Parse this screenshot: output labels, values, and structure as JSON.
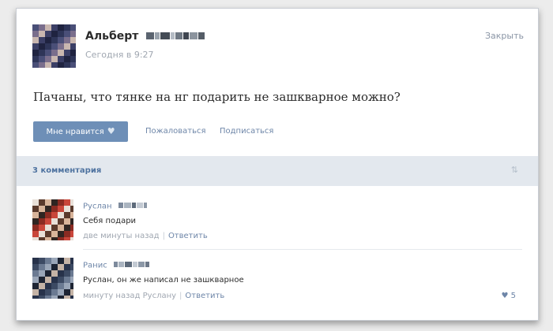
{
  "post": {
    "author_name": "Альберт",
    "time": "Сегодня в 9:27",
    "close_label": "Закрыть",
    "text": "Пачаны, что тянке на нг подарить не зашкварное можно?",
    "like_label": "Мне нравится",
    "report_label": "Пожаловаться",
    "subscribe_label": "Подписаться"
  },
  "comments_header": {
    "count_label": "3 комментария",
    "sort_icon": "sort-arrows-icon"
  },
  "comments": [
    {
      "name": "Руслан",
      "text": "Себя подари",
      "time": "две минуты назад",
      "reply_label": "Ответить"
    },
    {
      "name": "Ранис",
      "text": "Руслан, он же написал не зашкварное",
      "time": "минуту назад Руслану",
      "reply_label": "Ответить",
      "likes": "5"
    }
  ],
  "colors": {
    "accent": "#6e8fb7",
    "link": "#6e86a8",
    "header_bg": "#e3e8ee"
  }
}
